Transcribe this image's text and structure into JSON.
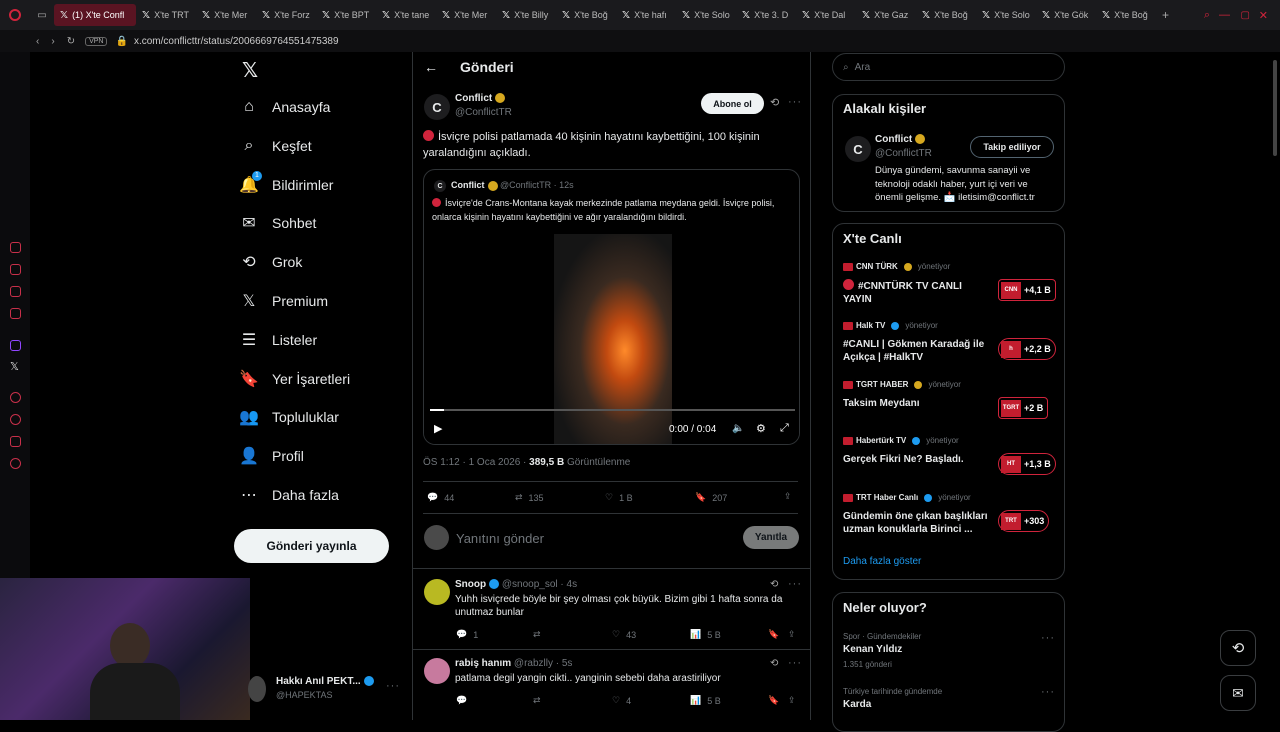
{
  "browser": {
    "active_tab": "(1) X'te Confl",
    "tabs": [
      "X'te TRT",
      "X'te Mer",
      "X'te Forz",
      "X'te BPT",
      "X'te tane",
      "X'te Mer",
      "X'te Billy",
      "X'te Boğ",
      "X'te hafı",
      "X'te Solo",
      "X'te 3. D",
      "X'te Dal",
      "X'te Gaz",
      "X'te Boğ",
      "X'te Solo",
      "X'te Gök",
      "X'te Boğ"
    ],
    "vpn": "VPN",
    "url": "x.com/conflicttr/status/2006669764551475389"
  },
  "nav": {
    "items": [
      "Anasayfa",
      "Keşfet",
      "Bildirimler",
      "Sohbet",
      "Grok",
      "Premium",
      "Listeler",
      "Yer İşaretleri",
      "Topluluklar",
      "Profil",
      "Daha fazla"
    ],
    "notif_count": "1",
    "post_button": "Gönderi yayınla",
    "user_name": "Hakkı Anıl PEKT...",
    "user_handle": "@HAPEKTAS"
  },
  "header": {
    "title": "Gönderi"
  },
  "post": {
    "name": "Conflict",
    "handle": "@ConflictTR",
    "subscribe": "Abone ol",
    "text": "İsviçre polisi patlamada 40 kişinin hayatını kaybettiğini, 100 kişinin yaralandığını açıkladı.",
    "quote": {
      "name": "Conflict",
      "handle": "@ConflictTR · 12s",
      "text": "İsviçre'de Crans-Montana kayak merkezinde patlama meydana geldi. İsviçre polisi, onlarca kişinin hayatını kaybettiğini ve ağır yaralandığını bildirdi.",
      "video_time": "0:00 / 0:04"
    },
    "time": "ÖS 1:12 · 1 Oca 2026 ·",
    "views": "389,5 B",
    "views_label": "Görüntülenme",
    "replies": "44",
    "reposts": "135",
    "likes": "1 B",
    "bookmarks": "207"
  },
  "reply_box": {
    "placeholder": "Yanıtını gönder",
    "button": "Yanıtla"
  },
  "replies": [
    {
      "name": "Snoop",
      "handle": "@snoop_sol · 4s",
      "text": "Yuhh isviçrede böyle bir şey olması çok büyük. Bizim gibi 1 hafta sonra da unutmaz bunlar",
      "replies": "1",
      "likes": "43",
      "views": "5 B"
    },
    {
      "name": "rabiş hanım",
      "handle": "@rabzlly · 5s",
      "text": "patlama degil yangin cikti.. yanginin sebebi daha arastiriliyor",
      "likes": "4",
      "views": "5 B"
    }
  ],
  "search": {
    "placeholder": "Ara"
  },
  "related": {
    "title": "Alakalı kişiler",
    "name": "Conflict",
    "handle": "@ConflictTR",
    "follow": "Takip ediliyor",
    "bio": "Dünya gündemi, savunma sanayii ve teknoloji odaklı haber, yurt içi veri ve önemli gelişme. 📩 iletisim@conflict.tr"
  },
  "live": {
    "title": "X'te Canlı",
    "managed": "yönetiyor",
    "items": [
      {
        "channel": "CNN TÜRK",
        "title": "#CNNTÜRK TV CANLI YAYIN",
        "count": "+4,1 B",
        "logo": "CNN"
      },
      {
        "channel": "Halk TV",
        "title": "#CANLI | Gökmen Karadağ ile Açıkça | #HalkTV",
        "count": "+2,2 B",
        "logo": "h"
      },
      {
        "channel": "TGRT HABER",
        "title": "Taksim Meydanı",
        "count": "+2 B",
        "logo": "TGRT"
      },
      {
        "channel": "Habertürk TV",
        "title": "Gerçek Fikri Ne? Başladı.",
        "count": "+1,3 B",
        "logo": "HT"
      },
      {
        "channel": "TRT Haber Canlı",
        "title": "Gündemin öne çıkan başlıkları uzman konuklarla Birinci ...",
        "count": "+303",
        "logo": "TRT"
      }
    ],
    "more": "Daha fazla göster"
  },
  "trends": {
    "title": "Neler oluyor?",
    "items": [
      {
        "sub": "Spor · Gündemdekiler",
        "title": "Kenan Yıldız",
        "count": "1.351 gönderi"
      },
      {
        "sub": "Türkiye tarihinde gündemde",
        "title": "Karda"
      }
    ]
  },
  "colors": {
    "accent_red": "#d0243c",
    "link": "#1d9bf0",
    "verified_gold": "#d6a81f"
  }
}
